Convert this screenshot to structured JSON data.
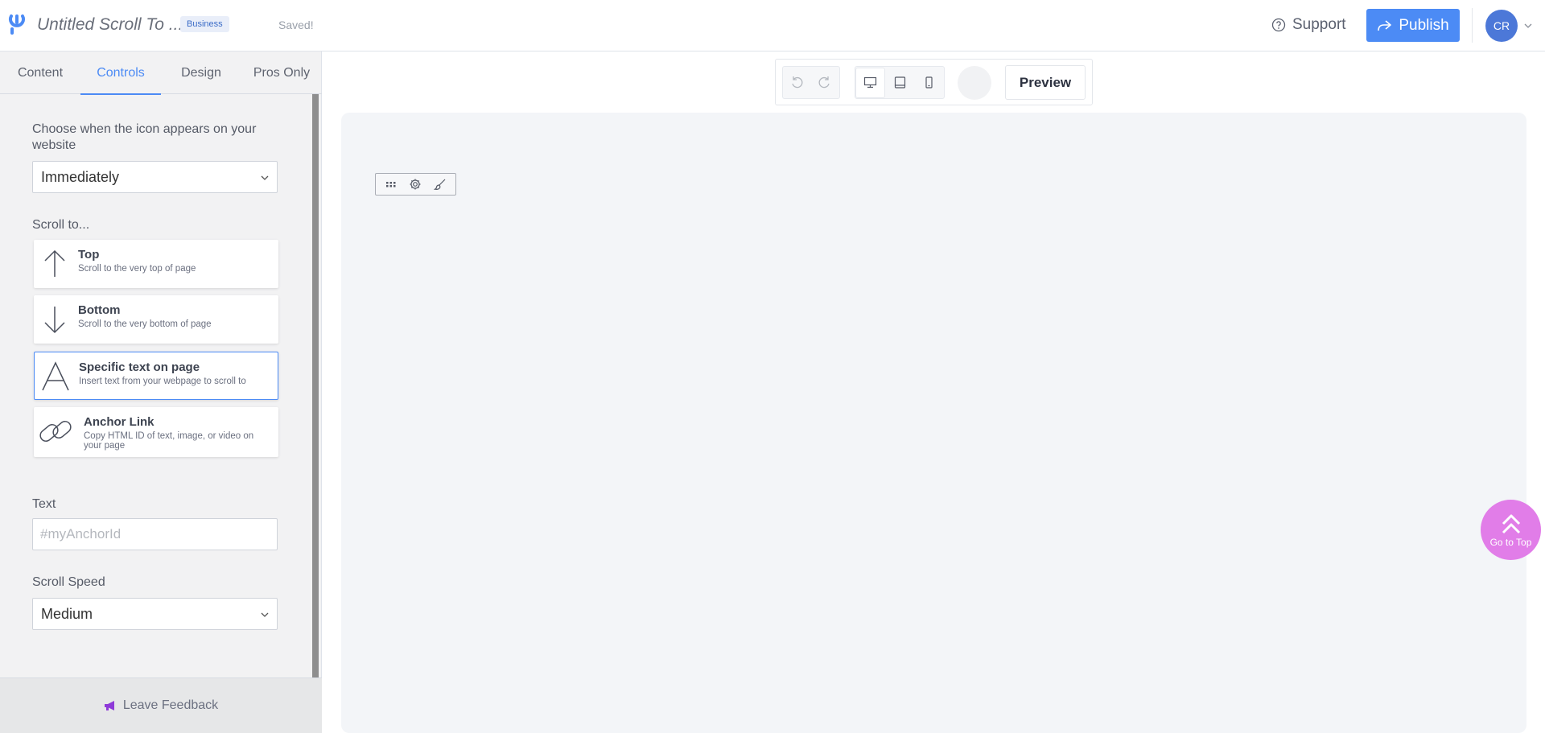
{
  "header": {
    "title": "Untitled Scroll To ...",
    "badge": "Business",
    "status": "Saved!",
    "support_label": "Support",
    "publish_label": "Publish",
    "avatar_initials": "CR"
  },
  "sidebar": {
    "tabs": [
      {
        "label": "Content"
      },
      {
        "label": "Controls",
        "active": true
      },
      {
        "label": "Design"
      },
      {
        "label": "Pros Only"
      }
    ],
    "appear_label": "Choose when the icon appears on your website",
    "appear_value": "Immediately",
    "scroll_to_label": "Scroll to...",
    "options": [
      {
        "title": "Top",
        "desc": "Scroll to the very top of page",
        "icon": "arrow-up-icon"
      },
      {
        "title": "Bottom",
        "desc": "Scroll to the very bottom of page",
        "icon": "arrow-down-icon"
      },
      {
        "title": "Specific text on page",
        "desc": "Insert text from your webpage to scroll to",
        "icon": "letter-a-icon",
        "selected": true
      },
      {
        "title": "Anchor Link",
        "desc": "Copy HTML ID of text, image, or video on your page",
        "icon": "link-icon"
      }
    ],
    "text_label": "Text",
    "text_placeholder": "#myAnchorId",
    "text_value": "",
    "speed_label": "Scroll Speed",
    "speed_value": "Medium",
    "feedback_label": "Leave Feedback"
  },
  "toolbar": {
    "preview_label": "Preview"
  },
  "widget": {
    "label": "Go to Top",
    "color": "#e17de8"
  },
  "colors": {
    "accent": "#4c8bf5",
    "avatar": "#4c78d8",
    "feedback_icon": "#8e3ad8"
  }
}
